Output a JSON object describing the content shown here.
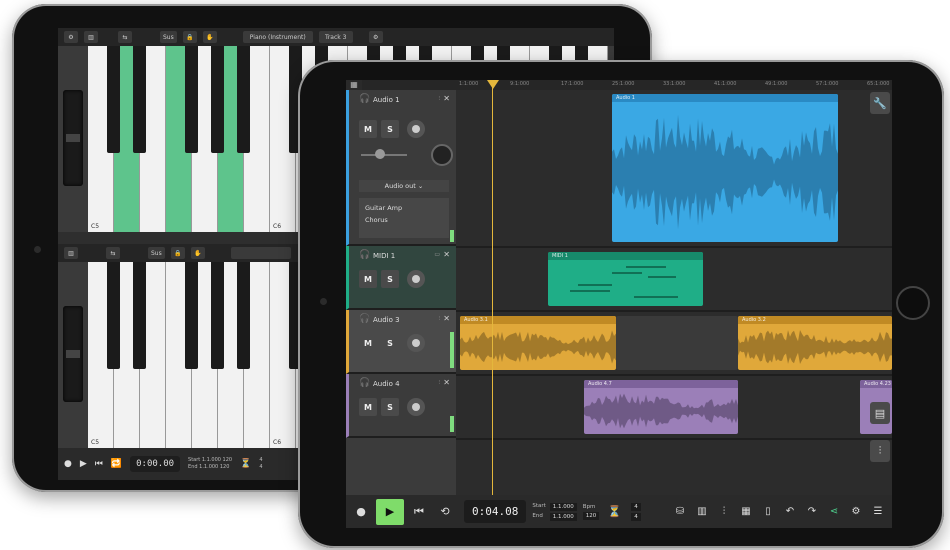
{
  "back_tablet": {
    "top_toolbar": {
      "labels": [
        "Sus",
        "Piano (Instrument)",
        "Track 3"
      ],
      "icons": [
        "gear-icon",
        "keyboard-icon",
        "swap-icon",
        "lock-icon",
        "hand-icon",
        "settings-icon"
      ]
    },
    "second_toolbar": {
      "labels": [
        "Sus"
      ]
    },
    "upper_keyboard": {
      "labels": [
        "C5",
        "C6"
      ],
      "highlighted_keys": [
        1,
        3,
        5
      ]
    },
    "lower_keyboard": {
      "labels": [
        "C5",
        "C6"
      ]
    },
    "transport": {
      "time": "0:00.00",
      "start_label": "Start",
      "start_value": "1.1.000",
      "end_label": "End",
      "end_value": "1.1.000",
      "bpm_value": "120",
      "sig_top": "4",
      "sig_bottom": "4"
    }
  },
  "front_tablet": {
    "ruler": [
      "1:1:000",
      "9:1:000",
      "17:1:000",
      "25:1:000",
      "33:1:000",
      "41:1:000",
      "49:1:000",
      "57:1:000",
      "65:1:000"
    ],
    "tracks": [
      {
        "name": "Audio 1",
        "color": "#3aa0e0",
        "output": "Audio out",
        "effects": [
          "Guitar Amp",
          "Chorus"
        ]
      },
      {
        "name": "MIDI 1",
        "color": "#1fae87"
      },
      {
        "name": "Audio 3",
        "color": "#e0a83a"
      },
      {
        "name": "Audio 4",
        "color": "#9b7fb8"
      }
    ],
    "buttons": {
      "mute": "M",
      "solo": "S"
    },
    "regions": {
      "audio1": "Audio 1",
      "midi1": "MIDI 1",
      "audio31": "Audio 3.1",
      "audio32": "Audio 3.2",
      "audio47": "Audio 4.7",
      "audio423": "Audio 4.23"
    },
    "transport": {
      "time": "0:04.08",
      "start_label": "Start",
      "start_value": "1.1.000",
      "end_label": "End",
      "end_value": "1.1.000",
      "bpm_label": "Bpm",
      "bpm_value": "120",
      "sig_top": "4",
      "sig_bottom": "4"
    },
    "accent_color": "#7fdc6a"
  }
}
